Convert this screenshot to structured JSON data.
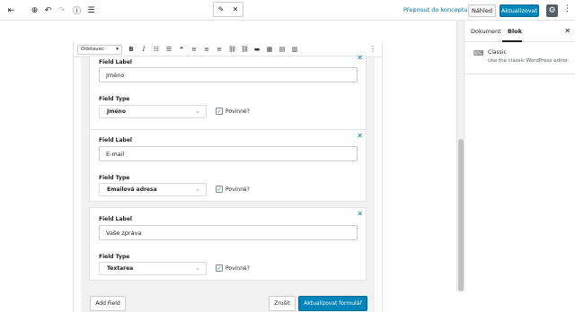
{
  "toolbar_top": {
    "draft_link": "Přepnout do konceptu",
    "preview_label": "Náhled",
    "update_label": "Aktualizovat"
  },
  "classic_toolbar": {
    "format_select": "Odstavec"
  },
  "fields": [
    {
      "label_title": "Field Label",
      "label_value": "Jméno",
      "type_title": "Field Type",
      "type_value": "Jméno",
      "required_label": "Povinné?"
    },
    {
      "label_title": "Field Label",
      "label_value": "E-mail",
      "type_title": "Field Type",
      "type_value": "Emailová adresa",
      "required_label": "Povinné?"
    },
    {
      "label_title": "Field Label",
      "label_value": "Vaše zpráva",
      "type_title": "Field Type",
      "type_value": "Textarea",
      "required_label": "Povinné?"
    }
  ],
  "actions": {
    "add_field": "Add Field",
    "cancel": "Zrušit",
    "save": "Aktualizovat formulář"
  },
  "sidebar": {
    "tab_document": "Dokument",
    "tab_block": "Blok",
    "block_title": "Classic",
    "block_desc": "Use the classic WordPress editor."
  },
  "colors": {
    "accent": "#0085ba",
    "link": "#0073aa"
  }
}
